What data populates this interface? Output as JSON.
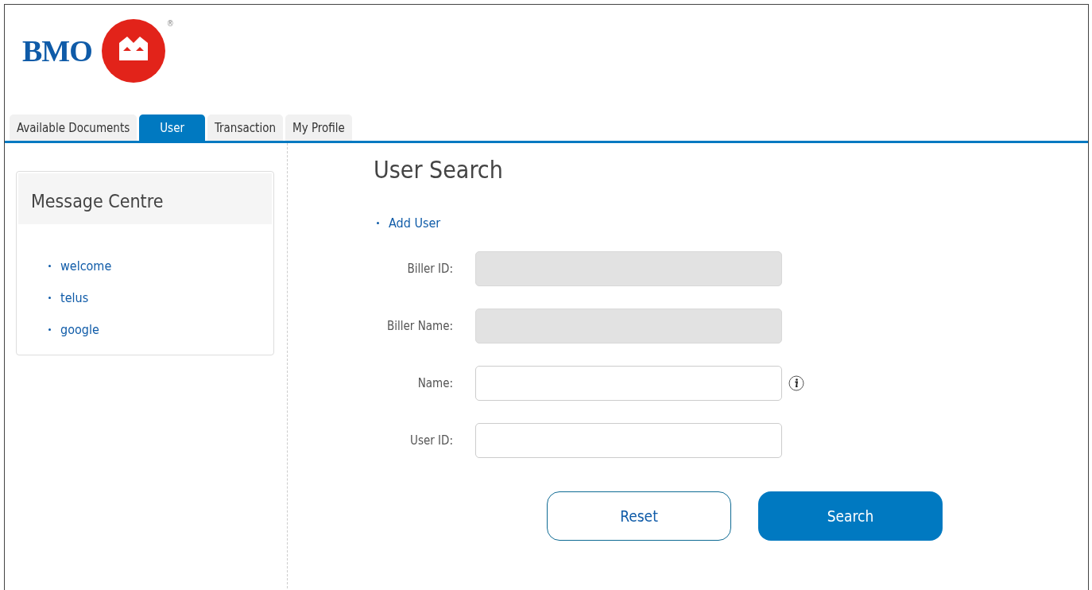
{
  "logo": {
    "wordmark": "BMO",
    "registered": "®"
  },
  "tabs": [
    {
      "label": "Available Documents",
      "selected": false
    },
    {
      "label": "User",
      "selected": true
    },
    {
      "label": "Transaction",
      "selected": false
    },
    {
      "label": "My Profile",
      "selected": false
    }
  ],
  "message_centre": {
    "title": "Message Centre",
    "items": [
      "welcome",
      "telus",
      "google"
    ]
  },
  "user_search": {
    "title": "User Search",
    "add_link": "Add User",
    "fields": [
      {
        "label": "Biller ID:",
        "disabled": true,
        "info": false
      },
      {
        "label": "Biller Name:",
        "disabled": true,
        "info": false
      },
      {
        "label": "Name:",
        "disabled": false,
        "info": true
      },
      {
        "label": "User ID:",
        "disabled": false,
        "info": false
      }
    ],
    "buttons": [
      {
        "label": "Reset",
        "kind": "secondary"
      },
      {
        "label": "Search",
        "kind": "primary"
      }
    ]
  }
}
